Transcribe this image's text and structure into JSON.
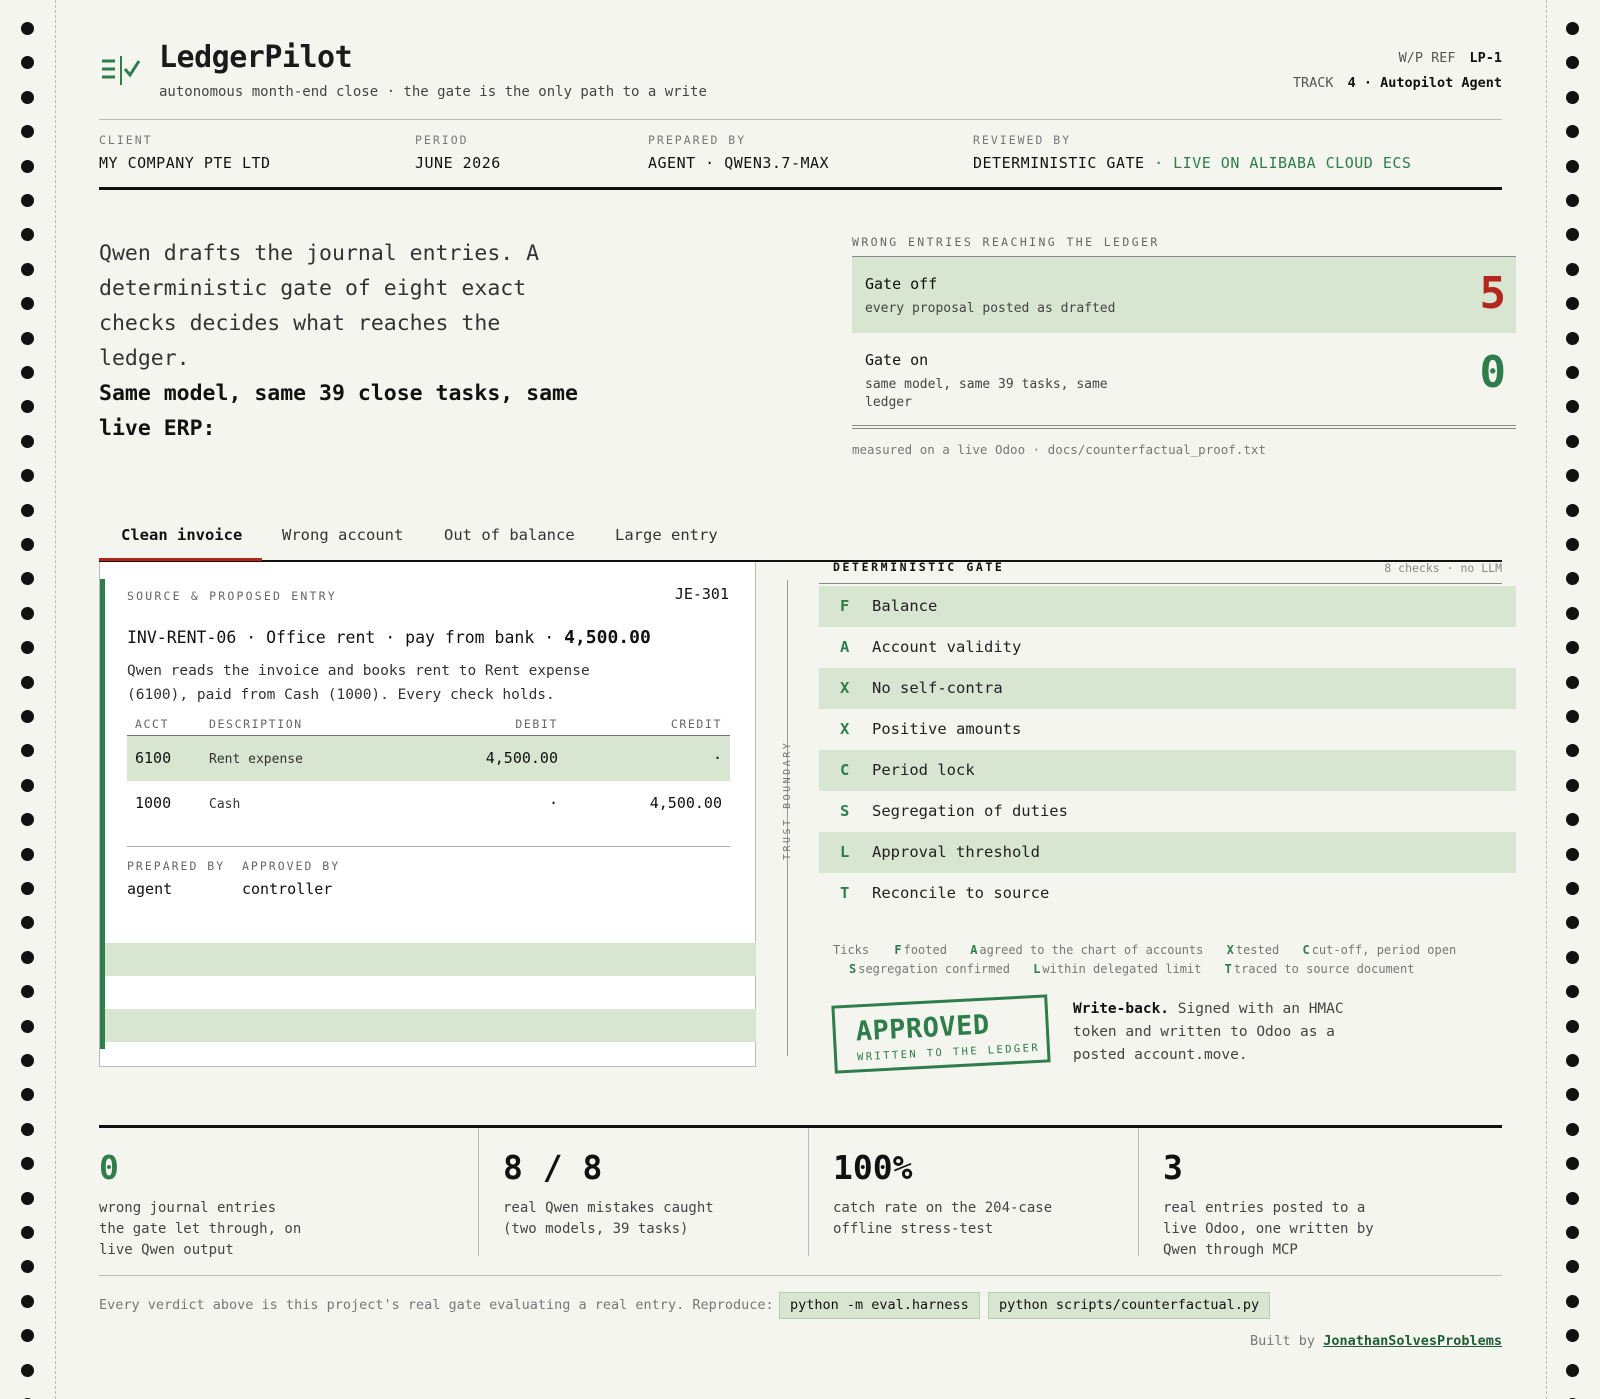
{
  "app": {
    "brand": "LedgerPilot",
    "tagline": "autonomous month-end close · the gate is the only path to a write",
    "wp_ref_label": "W/P REF",
    "wp_ref_value": "LP-1",
    "track_label": "TRACK",
    "track_value": "4 · Autopilot Agent",
    "icon": "ledger-check-icon"
  },
  "meta": {
    "client_label": "CLIENT",
    "client_value": "MY COMPANY PTE LTD",
    "period_label": "PERIOD",
    "period_value": "JUNE 2026",
    "prepared_label": "PREPARED BY",
    "prepared_value": "AGENT · QWEN3.7-MAX",
    "reviewed_label": "REVIEWED BY",
    "reviewed_value": "DETERMINISTIC GATE",
    "reviewed_live": " · LIVE ON ALIBABA CLOUD ECS"
  },
  "hero": {
    "line1": "Qwen drafts the journal entries. A deterministic gate of eight exact checks decides what reaches the ledger.",
    "line2": "Same model, same 39 close tasks, same live ERP:"
  },
  "wrong": {
    "label": "WRONG ENTRIES REACHING THE LEDGER",
    "off_title": "Gate off",
    "off_sub": "every proposal posted as drafted",
    "off_num": "5",
    "on_title": "Gate on",
    "on_sub": "same model, same 39 tasks, same ledger",
    "on_num": "0",
    "measured": "measured on a live Odoo · docs/counterfactual_proof.txt"
  },
  "tabs": [
    "Clean invoice",
    "Wrong account",
    "Out of balance",
    "Large entry"
  ],
  "entry": {
    "section_label": "SOURCE & PROPOSED ENTRY",
    "je_id": "JE-301",
    "invoice_line": "INV-RENT-06 · Office rent · pay from bank · ",
    "invoice_amount": "4,500.00",
    "description": "Qwen reads the invoice and books rent to Rent expense (6100), paid from Cash (1000). Every check holds.",
    "headers": {
      "acct": "ACCT",
      "desc": "DESCRIPTION",
      "debit": "DEBIT",
      "credit": "CREDIT"
    },
    "rows": [
      {
        "acct": "6100",
        "desc": "Rent expense",
        "debit": "4,500.00",
        "credit": "·"
      },
      {
        "acct": "1000",
        "desc": "Cash",
        "debit": "·",
        "credit": "4,500.00"
      }
    ],
    "prepared_label": "PREPARED BY",
    "prepared_value": "agent",
    "approved_label": "APPROVED BY",
    "approved_value": "controller"
  },
  "trust_boundary": "TRUST BOUNDARY",
  "gate": {
    "title": "DETERMINISTIC GATE",
    "meta": "8 checks · no LLM",
    "checks": [
      {
        "letter": "F",
        "name": "Balance"
      },
      {
        "letter": "A",
        "name": "Account validity"
      },
      {
        "letter": "X",
        "name": "No self-contra"
      },
      {
        "letter": "X",
        "name": "Positive amounts"
      },
      {
        "letter": "C",
        "name": "Period lock"
      },
      {
        "letter": "S",
        "name": "Segregation of duties"
      },
      {
        "letter": "L",
        "name": "Approval threshold"
      },
      {
        "letter": "T",
        "name": "Reconcile to source"
      }
    ],
    "legend_title": "Ticks",
    "legend": [
      {
        "letter": "F",
        "text": "footed"
      },
      {
        "letter": "A",
        "text": "agreed to the chart of accounts"
      },
      {
        "letter": "X",
        "text": "tested"
      },
      {
        "letter": "C",
        "text": "cut-off, period open"
      },
      {
        "letter": "S",
        "text": "segregation confirmed"
      },
      {
        "letter": "L",
        "text": "within delegated limit"
      },
      {
        "letter": "T",
        "text": "traced to source document"
      }
    ]
  },
  "stamp": {
    "big": "APPROVED",
    "small": "WRITTEN TO THE LEDGER"
  },
  "writeback": {
    "title": "Write-back.",
    "text": " Signed with an HMAC token and written to Odoo as a posted account.move."
  },
  "stats": [
    {
      "num": "0",
      "text": "wrong journal entries the gate let through, on live Qwen output"
    },
    {
      "num": "8 / 8",
      "text": "real Qwen mistakes caught (two models, 39 tasks)"
    },
    {
      "num": "100%",
      "text": "catch rate on the 204-case offline stress-test"
    },
    {
      "num": "3",
      "text": "real entries posted to a live Odoo, one written by Qwen through MCP"
    }
  ],
  "footer": {
    "text": "Every verdict above is this project's real gate evaluating a real entry. Reproduce:",
    "cmd1": "python -m eval.harness",
    "cmd2": "python scripts/counterfactual.py",
    "built_by": "Built by",
    "author": "JonathanSolvesProblems"
  },
  "colors": {
    "accent_green": "#2e7d4a",
    "accent_red": "#b3261e",
    "row_highlight": "#d7e5d1",
    "paper": "#f5f5f0"
  }
}
